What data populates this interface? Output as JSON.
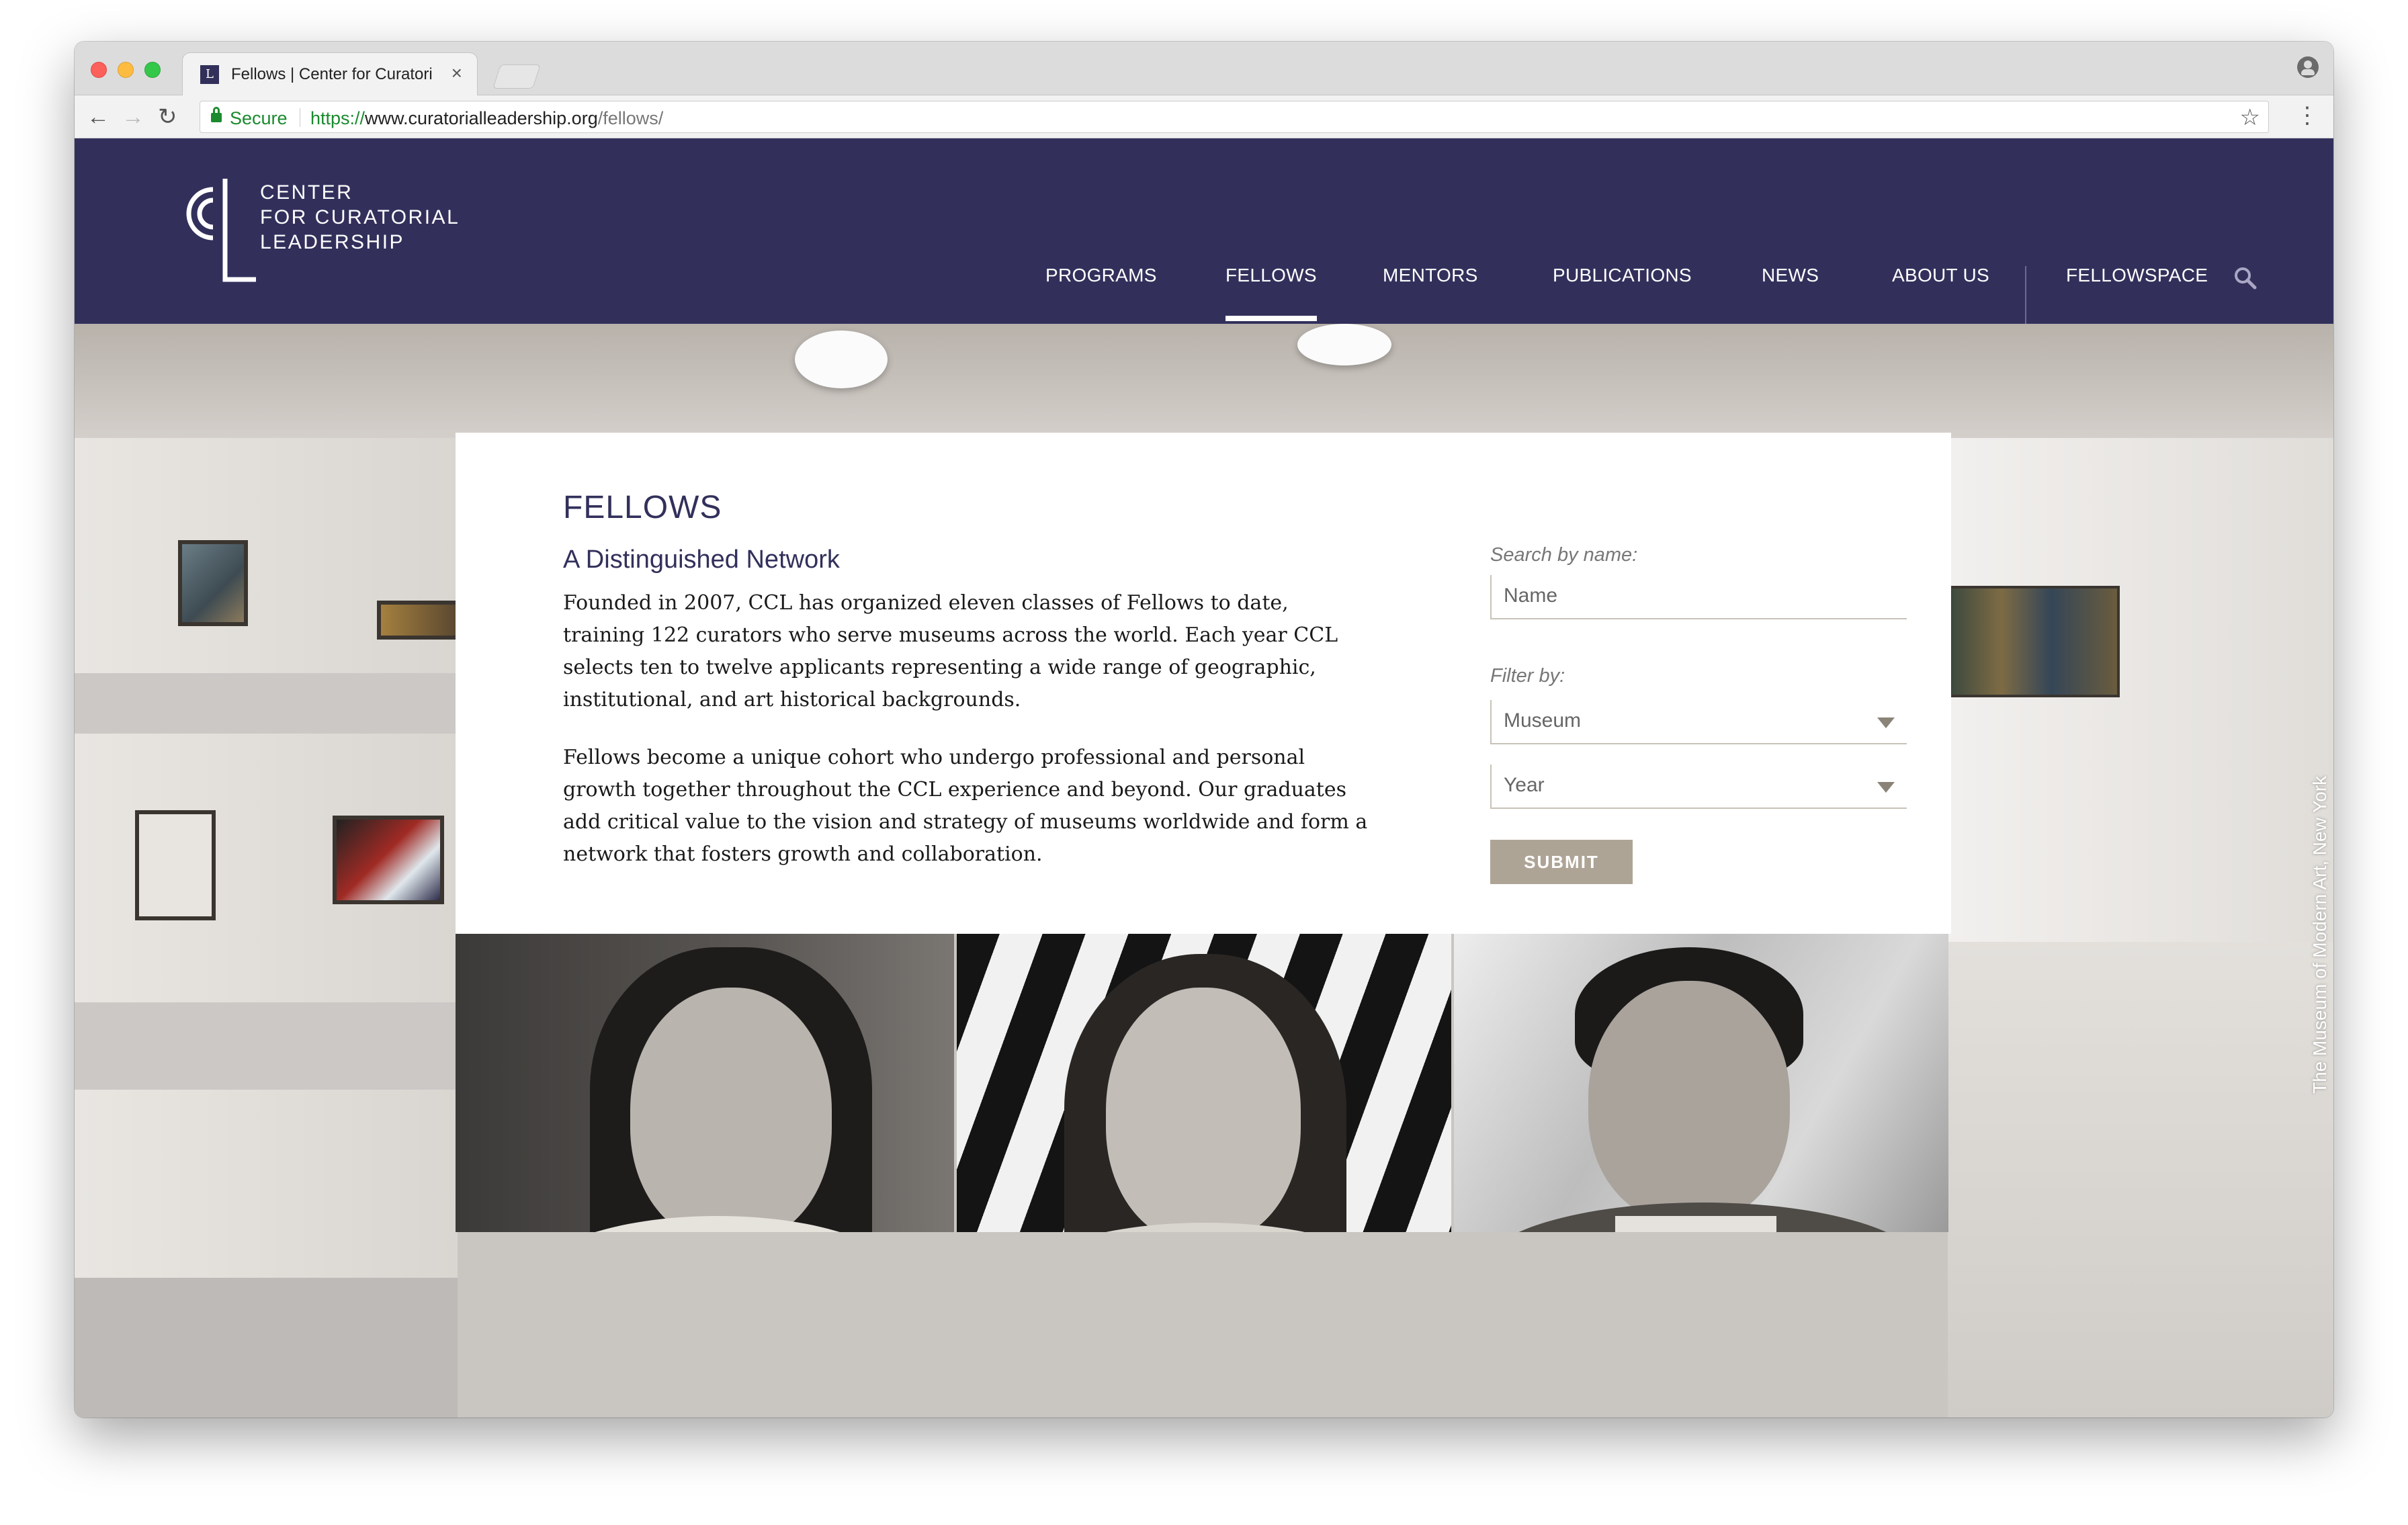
{
  "browser": {
    "tab_title": "Fellows | Center for Curatorial",
    "tab_close": "×",
    "favicon": "L",
    "secure_label": "Secure",
    "url_protocol": "https://",
    "url_host": "www.curatorialleadership.org",
    "url_path": "/fellows/",
    "back_glyph": "←",
    "forward_glyph": "→",
    "reload_glyph": "↻",
    "star_glyph": "☆",
    "menu_glyph": "⋮"
  },
  "site": {
    "logo_lines": [
      "CENTER",
      "FOR CURATORIAL",
      "LEADERSHIP"
    ],
    "nav": [
      {
        "label": "PROGRAMS",
        "active": false
      },
      {
        "label": "FELLOWS",
        "active": true
      },
      {
        "label": "MENTORS",
        "active": false
      },
      {
        "label": "PUBLICATIONS",
        "active": false
      },
      {
        "label": "NEWS",
        "active": false
      },
      {
        "label": "ABOUT US",
        "active": false
      },
      {
        "label": "FELLOWSPACE",
        "active": false
      }
    ],
    "brand_color": "#32305b",
    "accent_button_color": "#aea496"
  },
  "main": {
    "title": "FELLOWS",
    "subtitle": "A Distinguished Network",
    "paragraphs": [
      "Founded in 2007, CCL has organized eleven classes of Fellows to date, training 122 curators who serve museums across the world. Each year CCL selects ten to twelve applicants representing a wide range of geographic, institutional, and art historical backgrounds.",
      "Fellows become a unique cohort who undergo professional and personal growth together throughout the CCL experience and beyond. Our graduates add critical value to the vision and strategy of museums worldwide and form a network that fosters growth and collaboration."
    ]
  },
  "search": {
    "label": "Search by name:",
    "placeholder": "Name",
    "filter_label": "Filter by:",
    "museum_select": "Museum",
    "year_select": "Year",
    "submit_label": "SUBMIT"
  },
  "hero": {
    "caption": "The Museum of Modern Art, New York"
  }
}
